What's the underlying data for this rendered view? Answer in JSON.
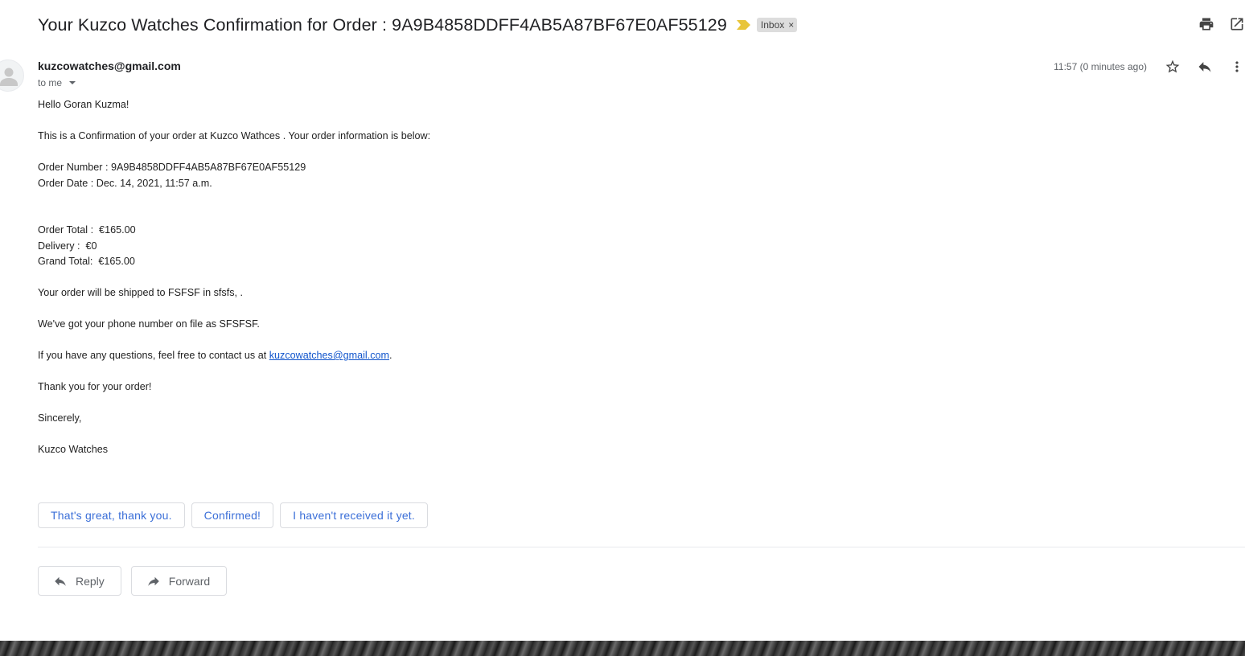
{
  "email": {
    "subject": "Your Kuzco Watches Confirmation for Order : 9A9B4858DDFF4AB5A87BF67E0AF55129",
    "label": "Inbox",
    "label_remove": "×",
    "sender": "kuzcowatches@gmail.com",
    "recipient": "to me",
    "time": "11:57 (0 minutes ago)"
  },
  "body": {
    "greeting": "Hello Goran Kuzma!",
    "intro": "This is a Confirmation of your order at Kuzco Wathces . Your order information is below:",
    "order_number": "Order Number : 9A9B4858DDFF4AB5A87BF67E0AF55129",
    "order_date": "Order Date : Dec. 14, 2021, 11:57 a.m.",
    "order_total": "Order Total :  €165.00",
    "delivery": "Delivery :  €0",
    "grand_total": "Grand Total:  €165.00",
    "shipping": "Your order will be shipped to FSFSF in sfsfs, .",
    "phone": "We've got your phone number on file as SFSFSF.",
    "contact_prefix": "If you have any questions, feel free to contact us at ",
    "contact_email": "kuzcowatches@gmail.com",
    "contact_suffix": ".",
    "thanks": "Thank you for your order!",
    "closing": "Sincerely,",
    "signature": "Kuzco Watches"
  },
  "smart_replies": [
    "That's great, thank you.",
    "Confirmed!",
    "I haven't received it yet."
  ],
  "actions": {
    "reply": "Reply",
    "forward": "Forward"
  },
  "icons": {
    "importance": "importance-marker-icon",
    "print": "print-icon",
    "open_new_window": "open-in-new-window-icon",
    "star": "star-icon",
    "reply": "reply-icon",
    "more": "more-vert-icon",
    "forward": "forward-icon",
    "avatar": "default-avatar-icon"
  },
  "colors": {
    "importance": "#E8C53A",
    "link": "#1155cc",
    "smart_reply_text": "#3b6fd8"
  }
}
